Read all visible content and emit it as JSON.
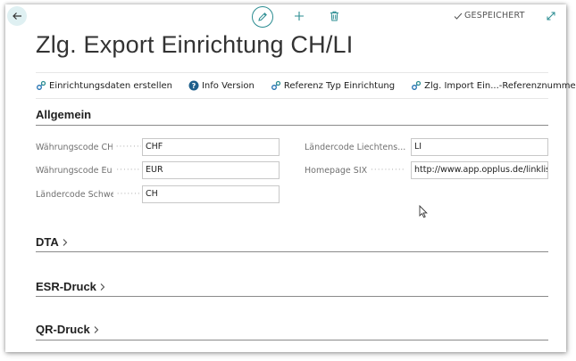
{
  "header": {
    "status": "GESPEICHERT"
  },
  "page": {
    "title": "Zlg. Export Einrichtung CH/LI"
  },
  "actions": [
    {
      "label": "Einrichtungsdaten erstellen",
      "icon": "process-icon"
    },
    {
      "label": "Info Version",
      "icon": "help-icon"
    },
    {
      "label": "Referenz Typ Einrichtung",
      "icon": "process-icon"
    },
    {
      "label": "Zlg. Import Ein...-Referenznummer",
      "icon": "process-icon"
    }
  ],
  "more_label": "···",
  "sections": {
    "allgemein": {
      "title": "Allgemein",
      "fields": {
        "waehrung_chf": {
          "label": "Währungscode CHF",
          "value": "CHF"
        },
        "waehrung_euro": {
          "label": "Währungscode Euro",
          "value": "EUR"
        },
        "laender_schweiz": {
          "label": "Ländercode Schweiz",
          "value": "CH"
        },
        "laender_liechtenstein": {
          "label": "Ländercode Liechtens...",
          "value": "LI"
        },
        "homepage_six": {
          "label": "Homepage SIX",
          "value": "http://www.app.opplus.de/linklist."
        }
      }
    },
    "dta": {
      "title": "DTA"
    },
    "esr": {
      "title": "ESR-Druck"
    },
    "qr": {
      "title": "QR-Druck"
    }
  },
  "colors": {
    "accent": "#2a8c91",
    "back_bg": "#dff0f2"
  }
}
